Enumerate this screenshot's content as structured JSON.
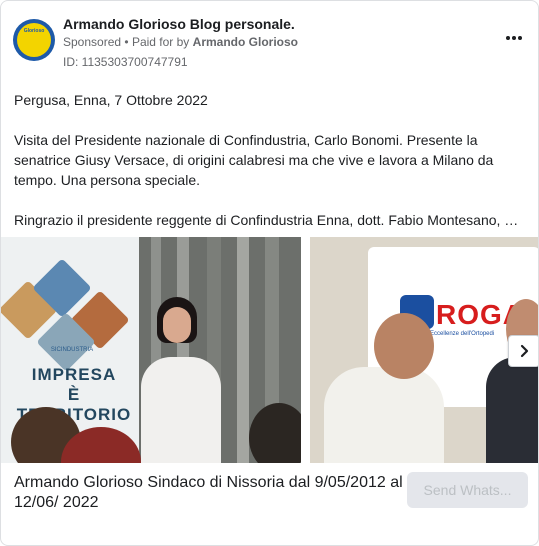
{
  "post": {
    "page_name": "Armando Glorioso Blog personale.",
    "sponsored": "Sponsored",
    "separator": "•",
    "paid_for_by_prefix": "Paid for by",
    "advertiser": "Armando Glorioso",
    "ad_id": "ID: 1135303700747791",
    "avatar_text": "Glorioso"
  },
  "body": {
    "paragraph_1": "Pergusa, Enna, 7 Ottobre 2022",
    "paragraph_2": "Visita del Presidente nazionale di Confindustria, Carlo Bonomi. Presente la senatrice Giusy Versace, di origini calabresi ma che vive e lavora a Milano da tempo. Una persona speciale.",
    "paragraph_3": "Ringrazio il presidente reggente di Confindustria Enna, dott. Fabio Montesano, pe..."
  },
  "carousel": {
    "photo_1": {
      "banner_org": "SICINDUSTRIA",
      "banner_line_1": "IMPRESA",
      "banner_line_2": "È",
      "banner_line_3": "TERRITORIO"
    },
    "photo_2": {
      "brand": "ROGA",
      "brand_sub": "Eccellenze dell'Ortopedi"
    }
  },
  "footer": {
    "caption": "Armando Glorioso Sindaco di Nissoria dal 9/05/2012 al 12/06/ 2022",
    "cta_label": "Send Whats..."
  },
  "colors": {
    "text_primary": "#1c1e21",
    "text_secondary": "#65676b",
    "cta_bg": "#e4e6eb",
    "cta_text": "#bcc0c4",
    "border": "#dddfe2"
  },
  "icons": {
    "more": "more-options-icon",
    "next": "chevron-right-icon"
  }
}
